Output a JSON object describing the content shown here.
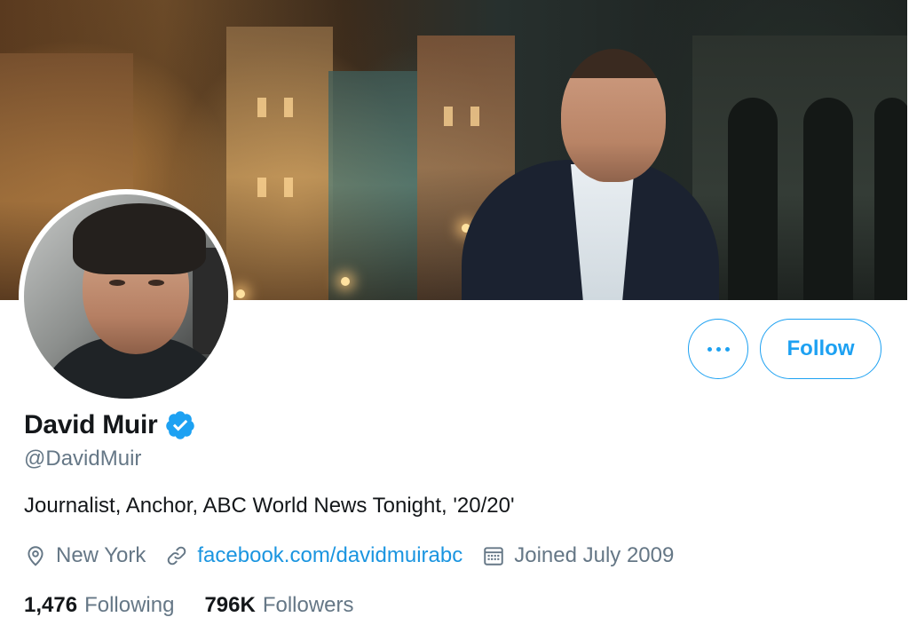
{
  "profile": {
    "name": "David Muir",
    "handle": "@DavidMuir",
    "bio": "Journalist, Anchor, ABC World News Tonight, '20/20'",
    "verified": true,
    "location": "New York",
    "website": "facebook.com/davidmuirabc",
    "joined": "Joined July 2009"
  },
  "actions": {
    "more_icon": "more-horizontal-icon",
    "follow_label": "Follow"
  },
  "stats": {
    "following_count": "1,476",
    "following_label": "Following",
    "followers_count": "796K",
    "followers_label": "Followers"
  },
  "icons": {
    "location": "location-pin-icon",
    "link": "link-icon",
    "calendar": "calendar-icon",
    "verified": "verified-badge-icon"
  },
  "colors": {
    "accent": "#1da1f2",
    "link": "#1b95e0",
    "text_primary": "#14171a",
    "text_secondary": "#657786"
  }
}
